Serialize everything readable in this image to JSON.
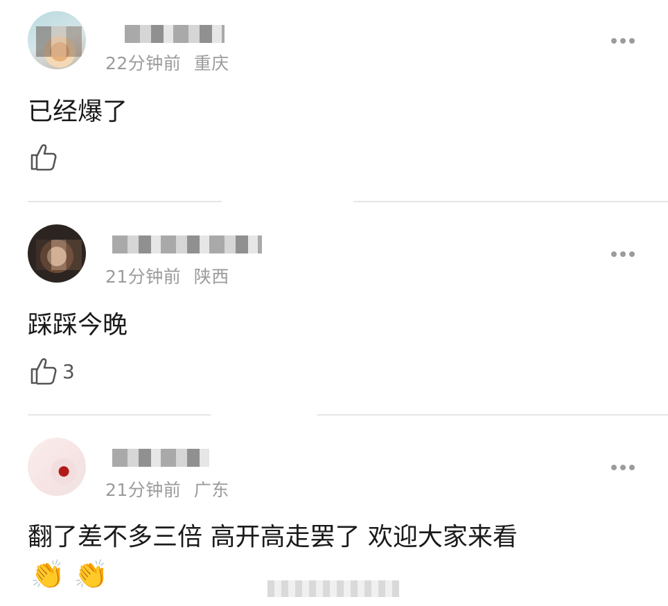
{
  "comments": [
    {
      "time": "22分钟前",
      "location": "重庆",
      "text": "已经爆了",
      "likes": "",
      "more_label": "•••"
    },
    {
      "time": "21分钟前",
      "location": "陕西",
      "text": "踩踩今晚",
      "likes": "3",
      "more_label": "•••"
    },
    {
      "time": "21分钟前",
      "location": "广东",
      "text": "翻了差不多三倍 高开高走罢了 欢迎大家来看",
      "likes": "",
      "emoji": "👏 👏",
      "more_label": "•••"
    }
  ],
  "icons": {
    "like": "thumbs-up-icon",
    "more": "more-dots-icon"
  }
}
